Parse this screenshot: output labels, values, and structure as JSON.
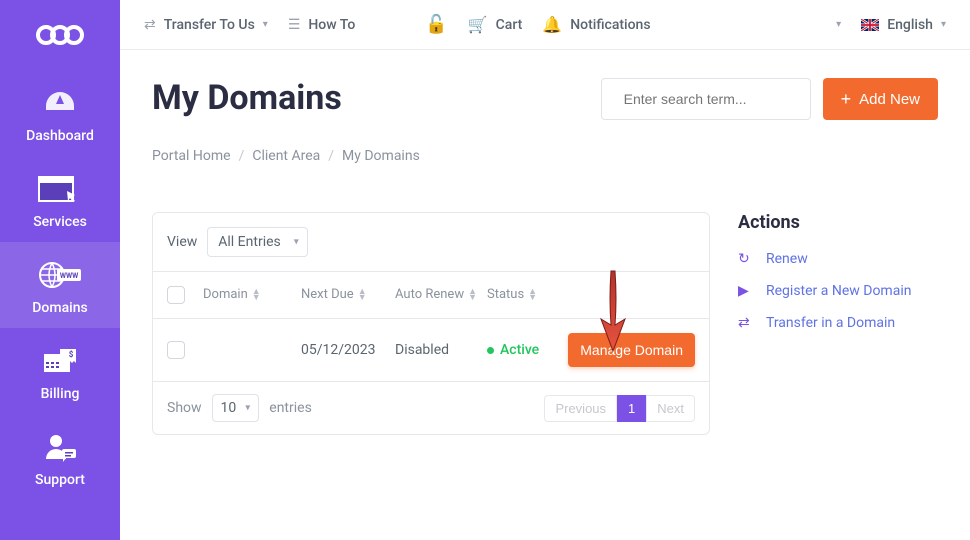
{
  "sidebar": {
    "items": [
      {
        "label": "Dashboard"
      },
      {
        "label": "Services"
      },
      {
        "label": "Domains"
      },
      {
        "label": "Billing"
      },
      {
        "label": "Support"
      }
    ]
  },
  "topbar": {
    "transfer": "Transfer To Us",
    "howto": "How To",
    "cart": "Cart",
    "notifications": "Notifications",
    "language": "English"
  },
  "page": {
    "title": "My Domains",
    "search_placeholder": "Enter search term...",
    "add_new": "Add New"
  },
  "breadcrumb": [
    "Portal Home",
    "Client Area",
    "My Domains"
  ],
  "filter": {
    "view_label": "View",
    "selected": "All Entries"
  },
  "table": {
    "headers": {
      "domain": "Domain",
      "next_due": "Next Due",
      "auto_renew": "Auto Renew",
      "status": "Status"
    },
    "rows": [
      {
        "due": "05/12/2023",
        "renew": "Disabled",
        "status": "Active",
        "action": "Manage Domain"
      }
    ]
  },
  "footer": {
    "show": "Show",
    "per_page": "10",
    "entries": "entries",
    "prev": "Previous",
    "page": "1",
    "next": "Next"
  },
  "actions": {
    "title": "Actions",
    "items": [
      {
        "label": "Renew"
      },
      {
        "label": "Register a New Domain"
      },
      {
        "label": "Transfer in a Domain"
      }
    ]
  }
}
